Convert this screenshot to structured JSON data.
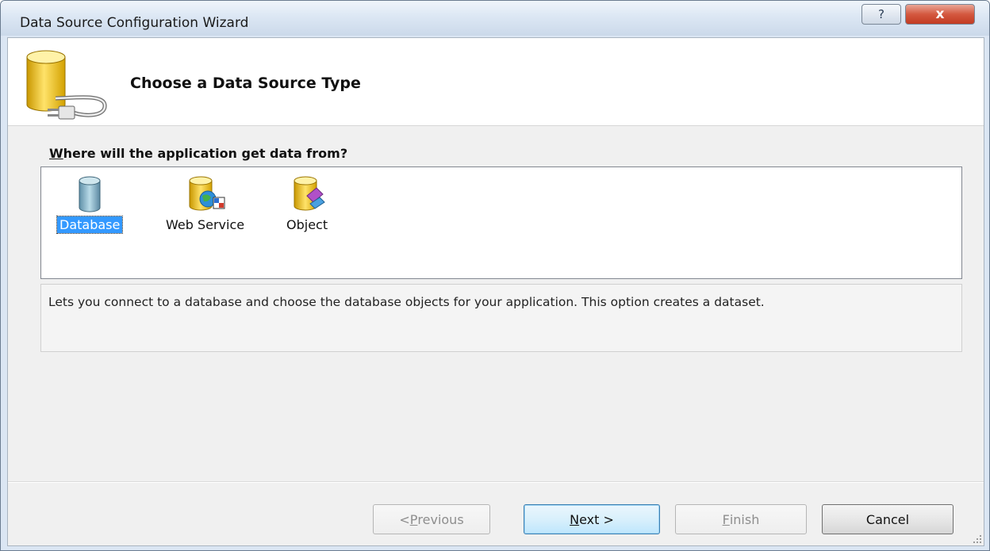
{
  "window": {
    "title": "Data Source Configuration Wizard",
    "help_glyph": "?",
    "close_glyph": "x"
  },
  "header": {
    "title": "Choose a Data Source Type"
  },
  "prompt": {
    "accel": "W",
    "rest": "here will the application get data from?"
  },
  "types": [
    {
      "label": "Database",
      "icon": "database-icon",
      "selected": true
    },
    {
      "label": "Web Service",
      "icon": "web-service-icon",
      "selected": false
    },
    {
      "label": "Object",
      "icon": "object-icon",
      "selected": false
    }
  ],
  "description": "Lets you connect to a database and choose the database objects for your application. This option creates a dataset.",
  "buttons": {
    "previous": {
      "prefix": "< ",
      "accel": "P",
      "rest": "revious",
      "enabled": false
    },
    "next": {
      "accel": "N",
      "rest": "ext >",
      "enabled": true
    },
    "finish": {
      "accel": "F",
      "rest": "inish",
      "enabled": false
    },
    "cancel": {
      "label": "Cancel",
      "enabled": true
    }
  },
  "colors": {
    "selection": "#3399ff",
    "title_bar": "#dce7f4",
    "close_button": "#c23b22",
    "cylinder_gold": "#e8b400"
  }
}
